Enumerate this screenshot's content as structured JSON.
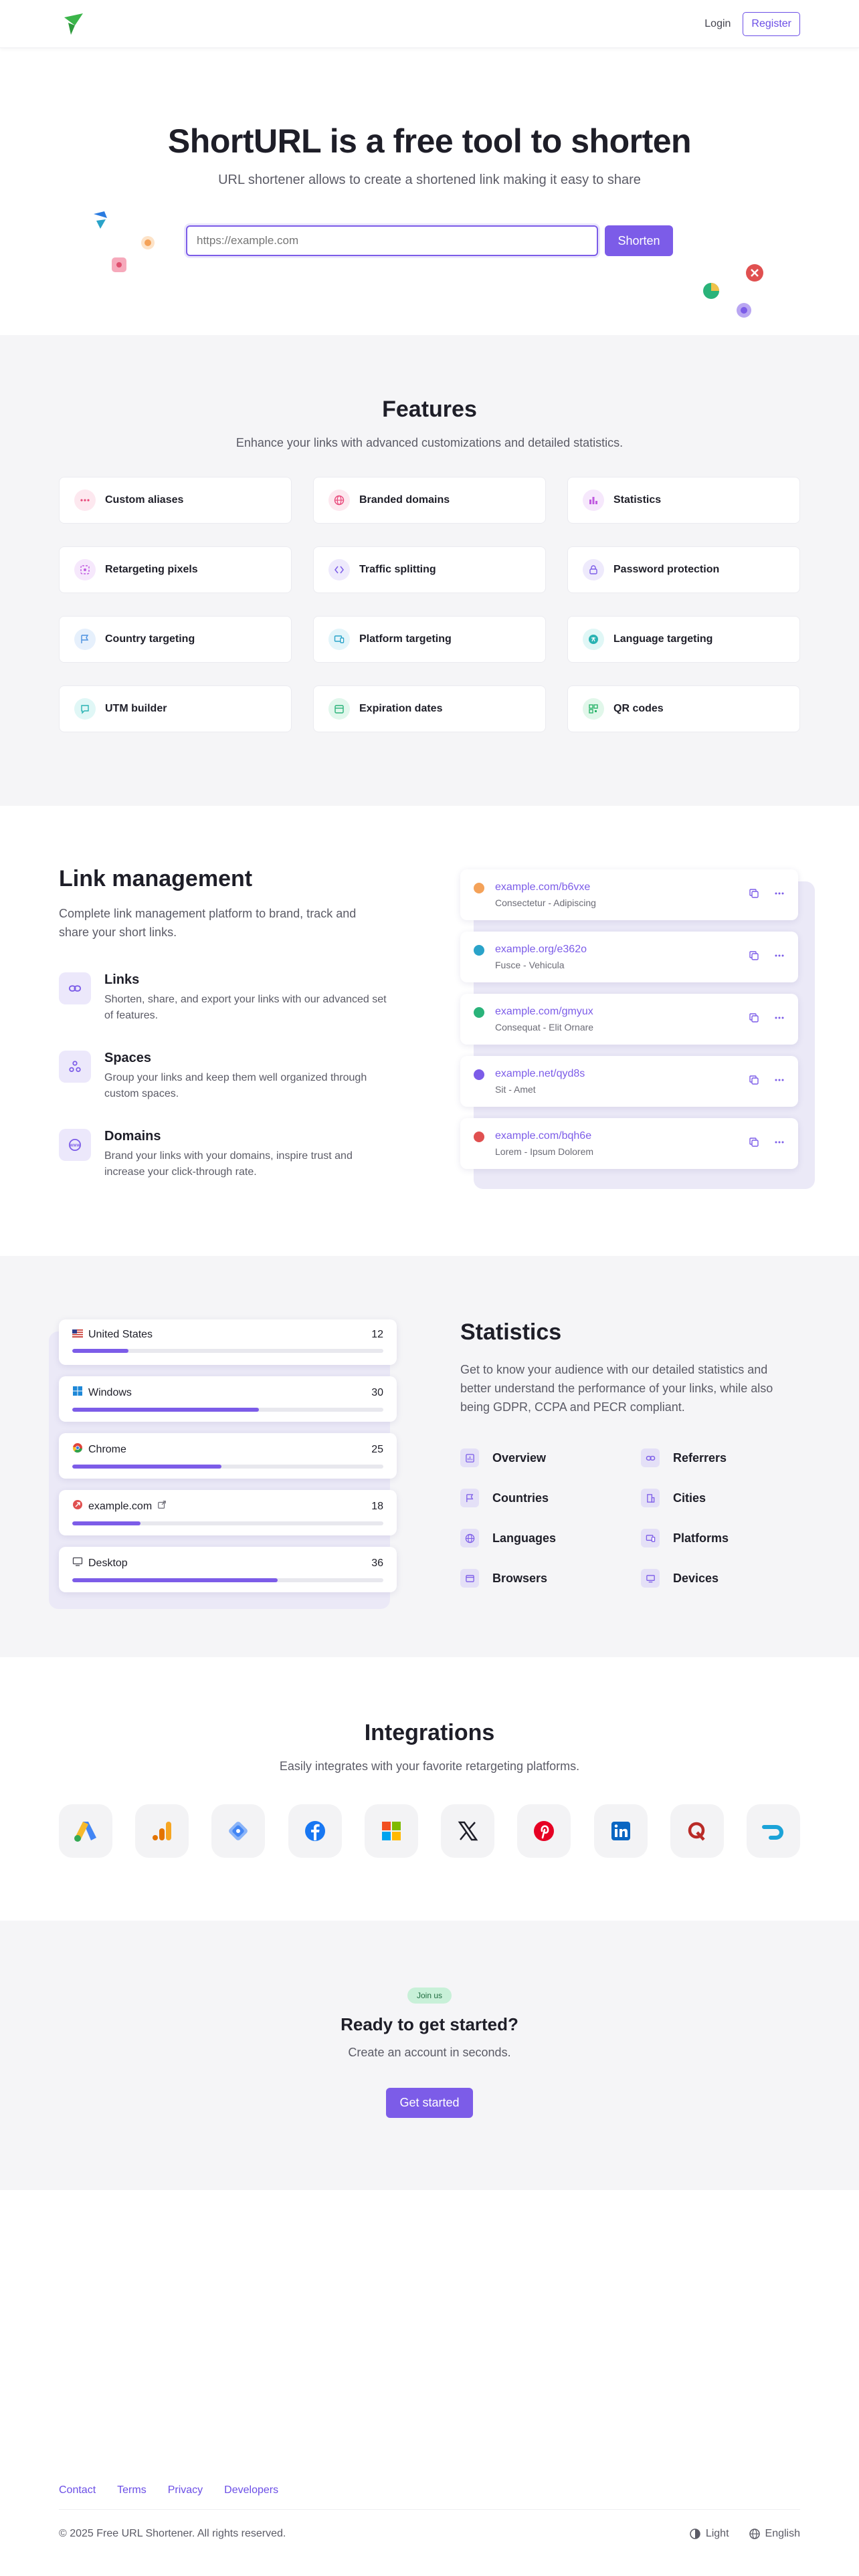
{
  "header": {
    "login": "Login",
    "register": "Register"
  },
  "hero": {
    "title": "ShortURL is a free tool to shorten",
    "subtitle": "URL shortener allows to create a shortened link making it easy to share",
    "input_placeholder": "https://example.com",
    "button": "Shorten"
  },
  "features": {
    "title": "Features",
    "subtitle": "Enhance your links with advanced customizations and detailed statistics.",
    "items": [
      {
        "label": "Custom aliases",
        "icon": "ellipsis-icon",
        "color": "#e8477a",
        "bg": "#fde8ef"
      },
      {
        "label": "Branded domains",
        "icon": "globe-icon",
        "color": "#e8477a",
        "bg": "#fde8ef"
      },
      {
        "label": "Statistics",
        "icon": "bar-chart-icon",
        "color": "#c05ae0",
        "bg": "#f6e8fc"
      },
      {
        "label": "Retargeting pixels",
        "icon": "target-icon",
        "color": "#c05ae0",
        "bg": "#f6e8fc"
      },
      {
        "label": "Traffic splitting",
        "icon": "split-icon",
        "color": "#7c5ce8",
        "bg": "#eeeafc"
      },
      {
        "label": "Password protection",
        "icon": "lock-icon",
        "color": "#7c5ce8",
        "bg": "#eeeafc"
      },
      {
        "label": "Country targeting",
        "icon": "flag-icon",
        "color": "#4a8fe0",
        "bg": "#e6f0fc"
      },
      {
        "label": "Platform targeting",
        "icon": "devices-icon",
        "color": "#2aa3c9",
        "bg": "#e3f5fa"
      },
      {
        "label": "Language targeting",
        "icon": "translate-icon",
        "color": "#2ab3b3",
        "bg": "#e0f7f6"
      },
      {
        "label": "UTM builder",
        "icon": "speech-bubble-icon",
        "color": "#2ab3b3",
        "bg": "#e0f7f6"
      },
      {
        "label": "Expiration dates",
        "icon": "calendar-icon",
        "color": "#2ab37a",
        "bg": "#e1f7ec"
      },
      {
        "label": "QR codes",
        "icon": "qr-code-icon",
        "color": "#2ab36a",
        "bg": "#e1f7ea"
      }
    ]
  },
  "link_management": {
    "title": "Link management",
    "description": "Complete link management platform to brand, track and share your short links.",
    "items": [
      {
        "title": "Links",
        "desc": "Shorten, share, and export your links with our advanced set of features.",
        "icon": "link-icon"
      },
      {
        "title": "Spaces",
        "desc": "Group your links and keep them well organized through custom spaces.",
        "icon": "spaces-icon"
      },
      {
        "title": "Domains",
        "desc": "Brand your links with your domains, inspire trust and increase your click-through rate.",
        "icon": "www-icon"
      }
    ],
    "links": [
      {
        "url": "example.com/b6vxe",
        "meta": "Consectetur - Adipiscing",
        "color": "#f4a259"
      },
      {
        "url": "example.org/e362o",
        "meta": "Fusce - Vehicula",
        "color": "#2aa3c9"
      },
      {
        "url": "example.com/gmyux",
        "meta": "Consequat - Elit Ornare",
        "color": "#2ab37a"
      },
      {
        "url": "example.net/qyd8s",
        "meta": "Sit - Amet",
        "color": "#7c5ce8"
      },
      {
        "url": "example.com/bqh6e",
        "meta": "Lorem - Ipsum Dolorem",
        "color": "#e05050"
      }
    ]
  },
  "statistics": {
    "title": "Statistics",
    "description": "Get to know your audience with our detailed statistics and better understand the performance of your links, while also being GDPR, CCPA and PECR compliant.",
    "cards": [
      {
        "label": "United States",
        "value": "12",
        "fraction": 0.18,
        "icon": "us-flag-icon"
      },
      {
        "label": "Windows",
        "value": "30",
        "fraction": 0.6,
        "icon": "windows-logo-icon"
      },
      {
        "label": "Chrome",
        "value": "25",
        "fraction": 0.48,
        "icon": "chrome-logo-icon"
      },
      {
        "label": "example.com",
        "value": "18",
        "fraction": 0.22,
        "icon": "referrer-icon"
      },
      {
        "label": "Desktop",
        "value": "36",
        "fraction": 0.66,
        "icon": "desktop-icon"
      }
    ],
    "items": [
      {
        "label": "Overview",
        "icon": "overview-icon"
      },
      {
        "label": "Referrers",
        "icon": "link-icon"
      },
      {
        "label": "Countries",
        "icon": "flag-icon"
      },
      {
        "label": "Cities",
        "icon": "building-icon"
      },
      {
        "label": "Languages",
        "icon": "globe-icon"
      },
      {
        "label": "Platforms",
        "icon": "devices-icon"
      },
      {
        "label": "Browsers",
        "icon": "browser-icon"
      },
      {
        "label": "Devices",
        "icon": "device-icon"
      }
    ]
  },
  "integrations": {
    "title": "Integrations",
    "subtitle": "Easily integrates with your favorite retargeting platforms.",
    "items": [
      "google-ads-logo-icon",
      "google-analytics-logo-icon",
      "google-tag-manager-logo-icon",
      "facebook-logo-icon",
      "microsoft-logo-icon",
      "x-logo-icon",
      "pinterest-logo-icon",
      "linkedin-logo-icon",
      "quora-logo-icon",
      "adroll-logo-icon"
    ]
  },
  "cta": {
    "badge": "Join us",
    "title": "Ready to get started?",
    "subtitle": "Create an account in seconds.",
    "button": "Get started"
  },
  "footer": {
    "links": [
      "Contact",
      "Terms",
      "Privacy",
      "Developers"
    ],
    "copyright": "© 2025 Free URL Shortener. All rights reserved.",
    "theme": "Light",
    "language": "English"
  }
}
